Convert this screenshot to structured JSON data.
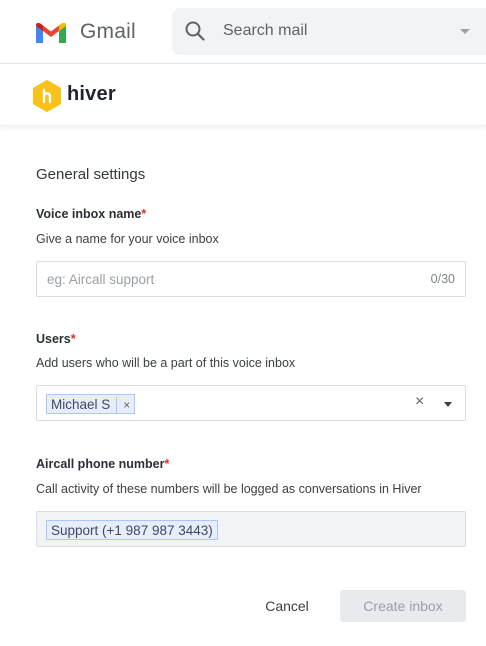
{
  "gmail": {
    "app_name": "Gmail",
    "search_placeholder": "Search mail"
  },
  "hiver": {
    "brand": "hiver"
  },
  "form": {
    "section_title": "General settings",
    "voice_inbox": {
      "label": "Voice inbox name",
      "required_mark": "*",
      "help": "Give a name for your voice inbox",
      "placeholder": "eg: Aircall support",
      "counter": "0/30"
    },
    "users": {
      "label": "Users",
      "required_mark": "*",
      "help": "Add users who will be a part of this voice inbox",
      "selected": [
        "Michael S"
      ],
      "chip_remove": "×",
      "clear": "×"
    },
    "phone": {
      "label": "Aircall phone number",
      "required_mark": "*",
      "help": "Call activity of these numbers will be logged as conversations in Hiver",
      "selected": [
        "Support (+1 987 987 3443)"
      ]
    }
  },
  "actions": {
    "cancel": "Cancel",
    "create": "Create inbox"
  },
  "colors": {
    "required": "#d93025",
    "chip_background": "#e8eef9",
    "chip_border": "#a8c7fa",
    "hiver_yellow": "#f9c21b",
    "disabled_button": "#e8eaed"
  }
}
